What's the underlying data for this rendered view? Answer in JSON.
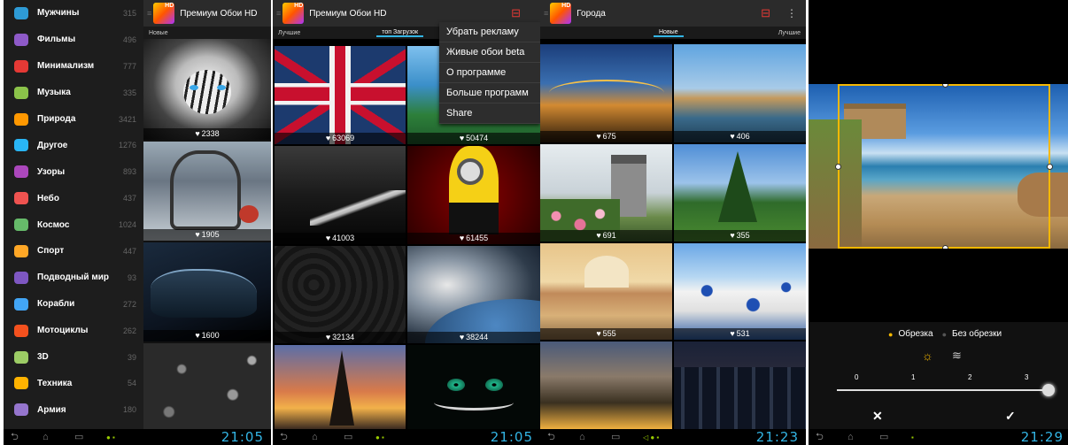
{
  "screen1": {
    "title": "Премиум Обои HD",
    "tab_new": "Новые",
    "categories": [
      {
        "label": "Мужчины",
        "count": "315",
        "color": "#2e9bd6"
      },
      {
        "label": "Фильмы",
        "count": "496",
        "color": "#8e5ac8"
      },
      {
        "label": "Минимализм",
        "count": "777",
        "color": "#e53935"
      },
      {
        "label": "Музыка",
        "count": "335",
        "color": "#8bc34a"
      },
      {
        "label": "Природа",
        "count": "3421",
        "color": "#ff9800"
      },
      {
        "label": "Другое",
        "count": "1276",
        "color": "#29b6f6"
      },
      {
        "label": "Узоры",
        "count": "893",
        "color": "#ab47bc"
      },
      {
        "label": "Небо",
        "count": "437",
        "color": "#ef5350"
      },
      {
        "label": "Космос",
        "count": "1024",
        "color": "#66bb6a"
      },
      {
        "label": "Спорт",
        "count": "447",
        "color": "#ffa726"
      },
      {
        "label": "Подводный мир",
        "count": "93",
        "color": "#7e57c2"
      },
      {
        "label": "Корабли",
        "count": "272",
        "color": "#42a5f5"
      },
      {
        "label": "Мотоциклы",
        "count": "262",
        "color": "#f4511e"
      },
      {
        "label": "3D",
        "count": "39",
        "color": "#9ccc65"
      },
      {
        "label": "Техника",
        "count": "54",
        "color": "#ffb300"
      },
      {
        "label": "Армия",
        "count": "180",
        "color": "#9575cd"
      }
    ],
    "tiles": [
      "2338",
      "1905",
      "1600",
      ""
    ],
    "clock": "21:05"
  },
  "screen2": {
    "title": "Премиум Обои HD",
    "tab_best": "Лучшие",
    "tab_top": "топ Загрузок",
    "menu": [
      "Убрать рекламу",
      "Живые обои beta",
      "О программе",
      "Больше программ",
      "Share"
    ],
    "tiles": [
      "63069",
      "50474",
      "41003",
      "61455",
      "32134",
      "38244",
      "",
      ""
    ],
    "clock": "21:05"
  },
  "screen3": {
    "title": "Города",
    "tab_new": "Новые",
    "tab_best": "Лучшие",
    "tiles": [
      "675",
      "406",
      "691",
      "355",
      "555",
      "531",
      "",
      ""
    ],
    "clock": "21:23"
  },
  "screen4": {
    "crop_label": "Обрезка",
    "nocrop_label": "Без обрезки",
    "ticks": [
      "0",
      "1",
      "2",
      "3"
    ],
    "slider_value": 3,
    "cancel": "✕",
    "confirm": "✓",
    "clock": "21:29"
  }
}
